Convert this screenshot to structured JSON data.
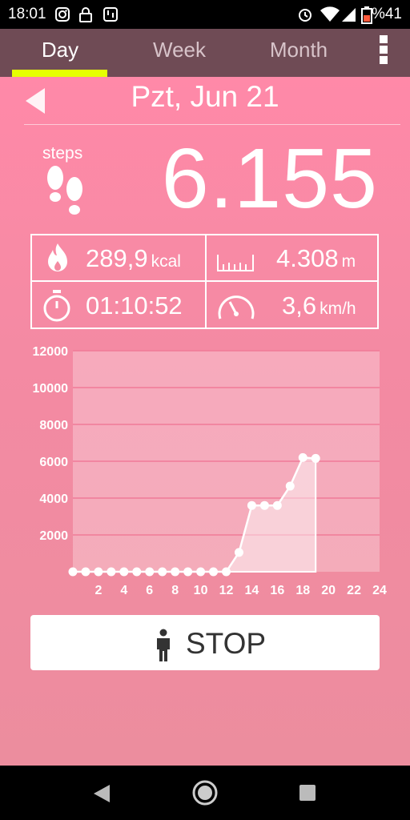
{
  "status_bar": {
    "time": "18:01",
    "battery": "%41",
    "icons": [
      "instagram-icon",
      "lock-icon",
      "app-icon",
      "alarm-icon",
      "wifi-icon",
      "signal-icon",
      "battery-icon"
    ]
  },
  "tabs": [
    {
      "label": "Day",
      "active": true
    },
    {
      "label": "Week",
      "active": false
    },
    {
      "label": "Month",
      "active": false
    }
  ],
  "date": "Pzt, Jun 21",
  "steps": {
    "label": "steps",
    "count": "6.155"
  },
  "stats": {
    "calories": {
      "value": "289,9",
      "unit": "kcal"
    },
    "distance": {
      "value": "4.308",
      "unit": "m"
    },
    "time": {
      "value": "01:10:52"
    },
    "speed": {
      "value": "3,6",
      "unit": "km/h"
    }
  },
  "chart_data": {
    "type": "area",
    "x": [
      0,
      1,
      2,
      3,
      4,
      5,
      6,
      7,
      8,
      9,
      10,
      11,
      12,
      13,
      14,
      15,
      16,
      17,
      18,
      19
    ],
    "values": [
      0,
      0,
      0,
      0,
      0,
      0,
      0,
      0,
      0,
      0,
      0,
      0,
      0,
      1050,
      3600,
      3600,
      3600,
      4650,
      6200,
      6155
    ],
    "x_ticks": [
      "2",
      "4",
      "6",
      "8",
      "10",
      "12",
      "14",
      "16",
      "18",
      "20",
      "22",
      "24"
    ],
    "y_ticks": [
      "2000",
      "4000",
      "6000",
      "8000",
      "10000",
      "12000"
    ],
    "xlim": [
      0,
      24
    ],
    "ylim": [
      0,
      12000
    ],
    "grid": true
  },
  "stop_button": {
    "label": "STOP"
  },
  "colors": {
    "accent": "#e6ff00",
    "tab_bar": "#6f4b55",
    "background": "#f48aa2"
  }
}
